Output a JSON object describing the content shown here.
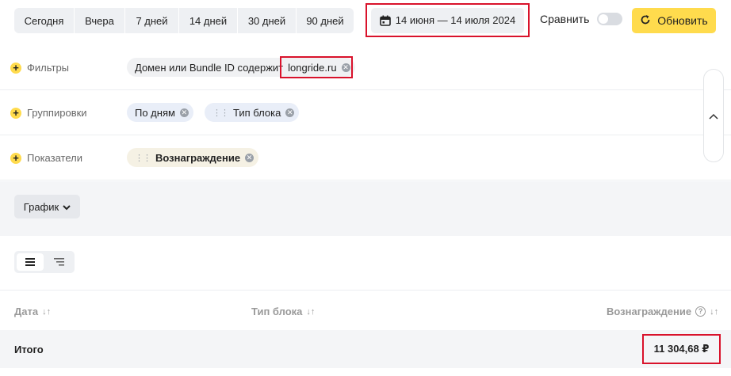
{
  "periods": [
    "Сегодня",
    "Вчера",
    "7 дней",
    "14 дней",
    "30 дней",
    "90 дней"
  ],
  "date_range": "14 июня — 14 июля 2024",
  "compare_label": "Сравнить",
  "refresh_label": "Обновить",
  "filters": {
    "label": "Фильтры",
    "chip_text": "Домен или Bundle ID содержит",
    "chip_value": "longride.ru"
  },
  "groupings": {
    "label": "Группировки",
    "chips": [
      "По дням",
      "Тип блока"
    ]
  },
  "metrics": {
    "label": "Показатели",
    "chips": [
      "Вознаграждение"
    ]
  },
  "chart_button": "График",
  "table": {
    "columns": [
      "Дата",
      "Тип блока",
      "Вознаграждение"
    ],
    "total_label": "Итого",
    "total_value": "11 304,68 ₽"
  },
  "colors": {
    "accent_yellow": "#ffdb4d",
    "highlight_red": "#d9122b"
  },
  "icons": {
    "calendar": "calendar-icon",
    "refresh": "refresh-icon",
    "chevron_up": "chevron-up-icon",
    "chevron_down": "chevron-down-icon",
    "sort": "sort-icon",
    "help": "help-icon"
  }
}
